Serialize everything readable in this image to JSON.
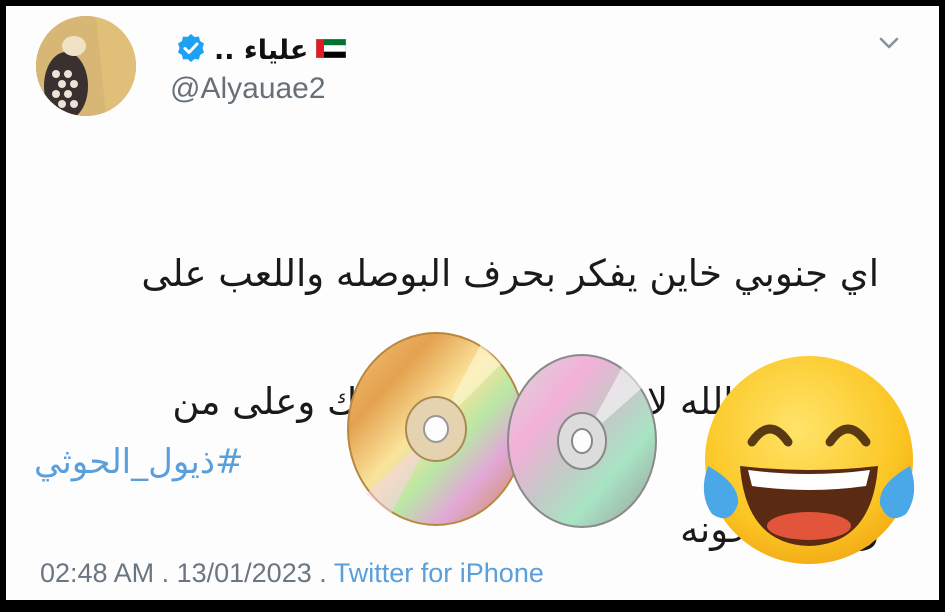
{
  "tweet": {
    "display_name": "علياء ..",
    "handle": "@Alyauae2",
    "text_lines": [
      "اي جنوبي خاين يفكر بحرف البوصله واللعب على",
      "المفتوح والله لا اعريك وادعس عليك وعلى من",
      "رباكم يا خونه"
    ],
    "hashtag": "#ذيول_الحوثي",
    "time": "02:48 AM",
    "date": "13/01/2023",
    "source": "Twitter for iPhone",
    "separator": " . "
  },
  "icons": {
    "verified": "verified-badge-icon",
    "flag": "uae-flag-icon",
    "chevron": "chevron-down-icon",
    "emoji": "tears-of-joy-emoji",
    "disc": "compact-disc-icon"
  },
  "colors": {
    "link": "#5a9fdb",
    "verified": "#1da1f2",
    "text": "#1a1a1a",
    "muted": "#667079"
  }
}
